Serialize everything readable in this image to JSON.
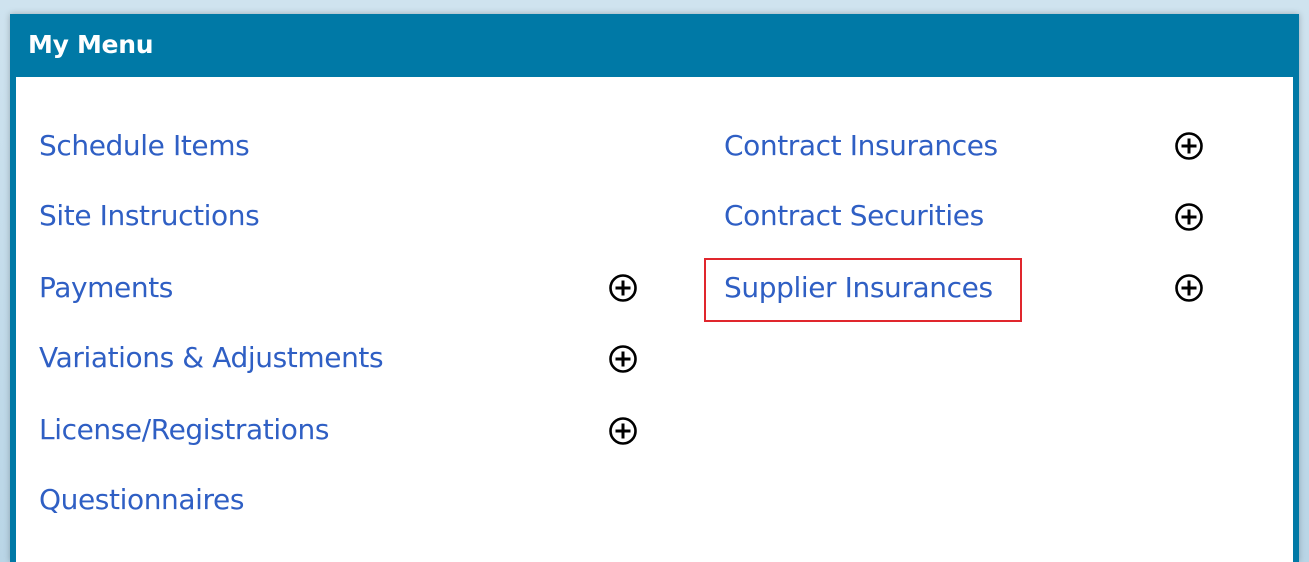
{
  "panel": {
    "title": "My Menu"
  },
  "menu": {
    "left": [
      {
        "label": "Schedule Items",
        "expandable": false
      },
      {
        "label": "Site Instructions",
        "expandable": false
      },
      {
        "label": "Payments",
        "expandable": true
      },
      {
        "label": "Variations & Adjustments",
        "expandable": true
      },
      {
        "label": "License/Registrations",
        "expandable": true
      },
      {
        "label": "Questionnaires",
        "expandable": false
      }
    ],
    "right": [
      {
        "label": "Contract Insurances",
        "expandable": true
      },
      {
        "label": "Contract Securities",
        "expandable": true
      },
      {
        "label": "Supplier Insurances",
        "expandable": true,
        "highlighted": true
      }
    ]
  },
  "icons": {
    "expand": "plus-circle-icon"
  },
  "colors": {
    "header_bg": "#0079a6",
    "link": "#2f5fc4",
    "highlight": "#e0262d"
  }
}
